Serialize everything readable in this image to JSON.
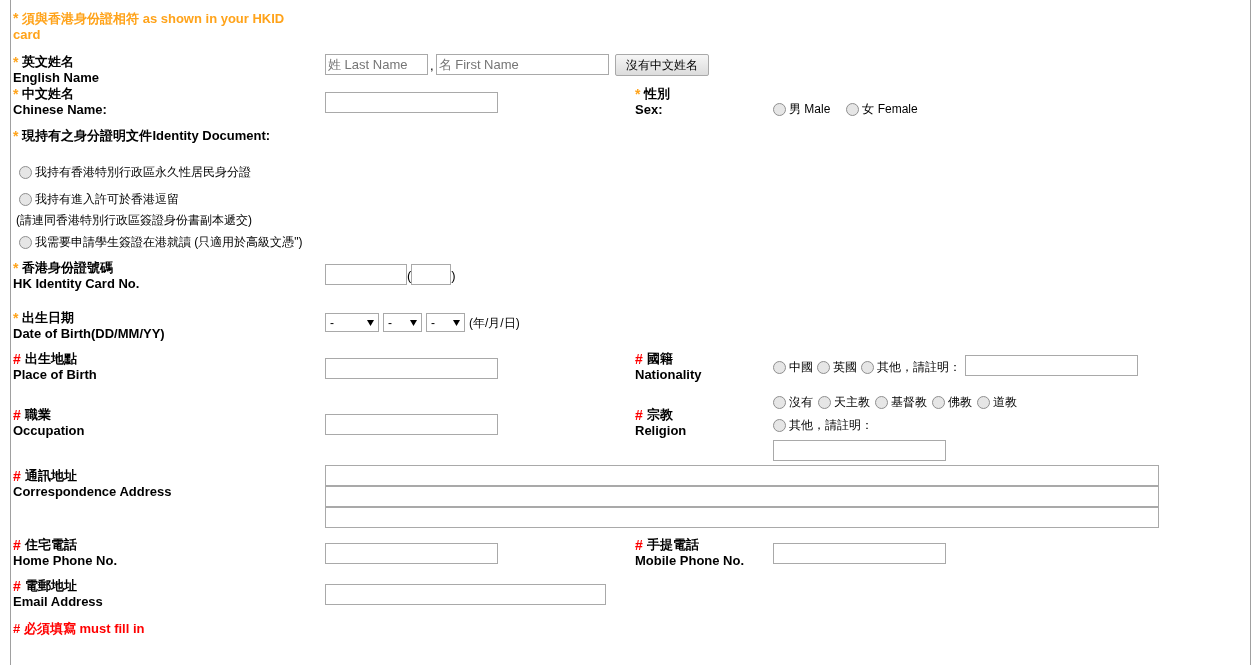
{
  "notice": {
    "mark": "*",
    "color": "#ffa31a",
    "text": "須與香港身份證相符 as shown in your HKID card"
  },
  "english_name": {
    "mark": "*",
    "color": "#ffa31a",
    "zh": "英文姓名",
    "en": "English Name",
    "last_placeholder": "姓 Last Name",
    "separator": ",",
    "first_placeholder": "名 First Name",
    "button": "沒有中文姓名"
  },
  "chinese_name": {
    "mark": "*",
    "color": "#ffa31a",
    "zh": "中文姓名",
    "en": "Chinese Name:"
  },
  "sex": {
    "mark": "*",
    "color": "#ffa31a",
    "zh": "性別",
    "en": "Sex:",
    "options": [
      {
        "label": "男 Male",
        "selected": false
      },
      {
        "label": "女 Female",
        "selected": false
      }
    ]
  },
  "identity_document": {
    "mark": "*",
    "color": "#ffa31a",
    "label": "現持有之身分證明文件Identity Document:",
    "options": [
      {
        "label": "我持有香港特別行政區永久性居民身分證",
        "selected": false
      },
      {
        "label": "我持有進入許可於香港逗留",
        "note": "(請連同香港特別行政區簽證身份書副本遞交)",
        "selected": false
      },
      {
        "label": "我需要申請學生簽證在港就讀 (只適用於高級文憑\")",
        "selected": false
      }
    ]
  },
  "hkid": {
    "mark": "*",
    "color": "#ffa31a",
    "zh": "香港身份證號碼",
    "en": "HK Identity Card No.",
    "open": "(",
    "close": ")"
  },
  "date_of_birth": {
    "mark": "*",
    "color": "#ffa31a",
    "zh": "出生日期",
    "en": "Date of Birth(DD/MM/YY)",
    "selects": [
      {
        "value": "-"
      },
      {
        "value": "-"
      },
      {
        "value": "-"
      }
    ],
    "hint": "(年/月/日)"
  },
  "place_of_birth": {
    "mark": "#",
    "color": "#ff0000",
    "zh": "出生地點",
    "en": "Place of Birth"
  },
  "nationality": {
    "mark": "#",
    "color": "#ff0000",
    "zh": "國籍",
    "en": "Nationality",
    "options": [
      {
        "label": "中國",
        "selected": false
      },
      {
        "label": "英國",
        "selected": false
      },
      {
        "label": "其他，請註明：",
        "selected": false
      }
    ]
  },
  "occupation": {
    "mark": "#",
    "color": "#ff0000",
    "zh": "職業",
    "en": "Occupation"
  },
  "religion": {
    "mark": "#",
    "color": "#ff0000",
    "zh": "宗教",
    "en": "Religion",
    "options": [
      {
        "label": "沒有",
        "selected": false
      },
      {
        "label": "天主教",
        "selected": false
      },
      {
        "label": "基督教",
        "selected": false
      },
      {
        "label": "佛教",
        "selected": false
      },
      {
        "label": "道教",
        "selected": false
      }
    ],
    "other_option": {
      "label": "其他，請註明：",
      "selected": false
    }
  },
  "address": {
    "mark": "#",
    "color": "#ff0000",
    "zh": "通訊地址",
    "en": "Correspondence Address"
  },
  "home_phone": {
    "mark": "#",
    "color": "#ff0000",
    "zh": "住宅電話",
    "en": "Home Phone No."
  },
  "mobile_phone": {
    "mark": "#",
    "color": "#ff0000",
    "zh": "手提電話",
    "en": "Mobile Phone No."
  },
  "email": {
    "mark": "#",
    "color": "#ff0000",
    "zh": "電郵地址",
    "en": "Email Address"
  },
  "footer": {
    "mark": "#",
    "color": "#ff0000",
    "text": "必須填寫 must fill in"
  }
}
